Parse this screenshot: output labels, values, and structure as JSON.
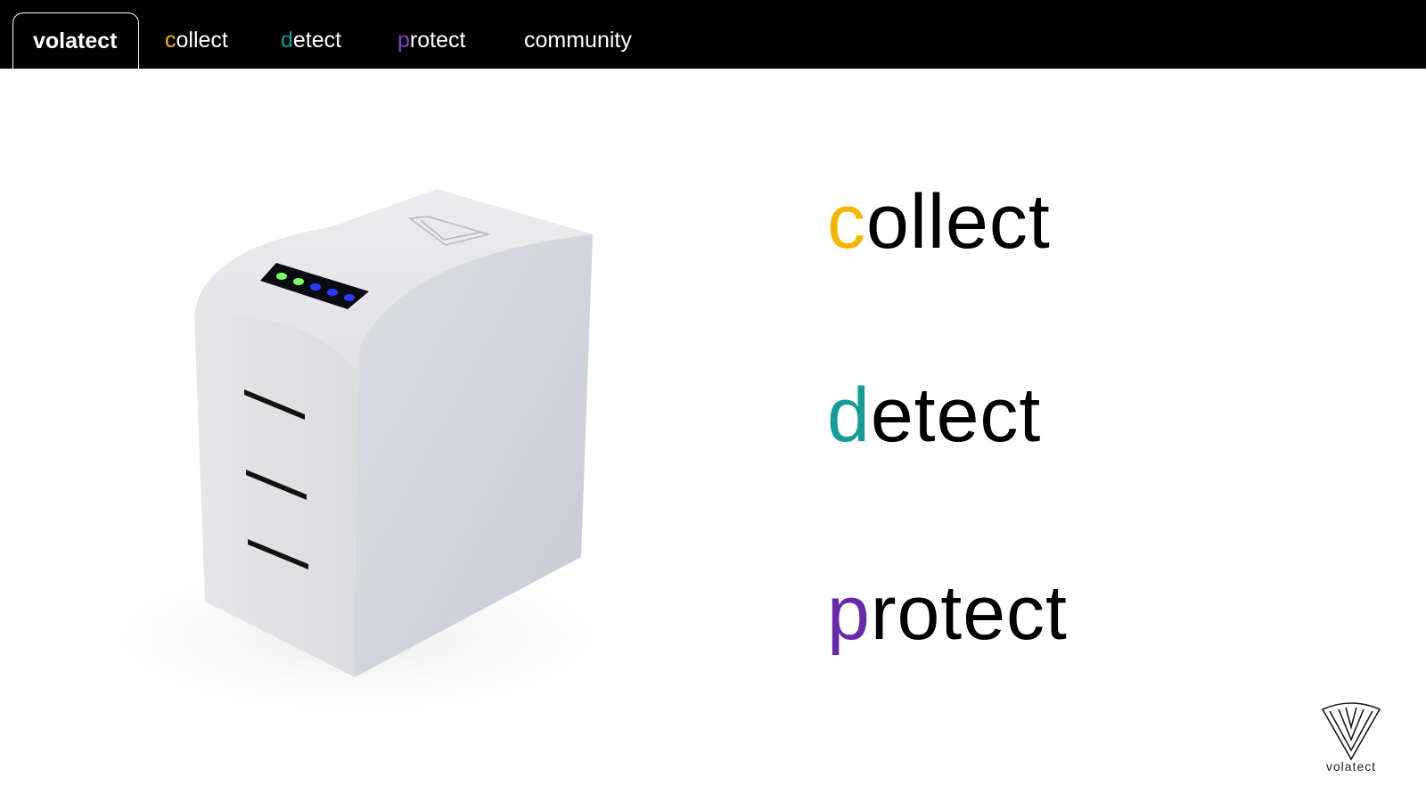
{
  "nav": {
    "tabs": [
      {
        "first": "",
        "rest": "volatect",
        "active": true
      },
      {
        "first": "c",
        "rest": "ollect",
        "color": "#f2b705"
      },
      {
        "first": "d",
        "rest": "etect",
        "color": "#169c93"
      },
      {
        "first": "p",
        "rest": "rotect",
        "color": "#7a35b8"
      },
      {
        "first": "",
        "rest": "community"
      }
    ]
  },
  "hero": {
    "words": [
      {
        "first": "c",
        "rest": "ollect",
        "color": "#f2b705"
      },
      {
        "first": "d",
        "rest": "etect",
        "color": "#169c93"
      },
      {
        "first": "p",
        "rest": "rotect",
        "color": "#6a2aa8"
      }
    ],
    "device_leds": [
      "#7cff6a",
      "#7cff6a",
      "#2b3cff",
      "#2b3cff",
      "#2b3cff"
    ]
  },
  "brand": {
    "label": "volatect"
  },
  "colors": {
    "navbar": "#000000",
    "background": "#ffffff"
  }
}
